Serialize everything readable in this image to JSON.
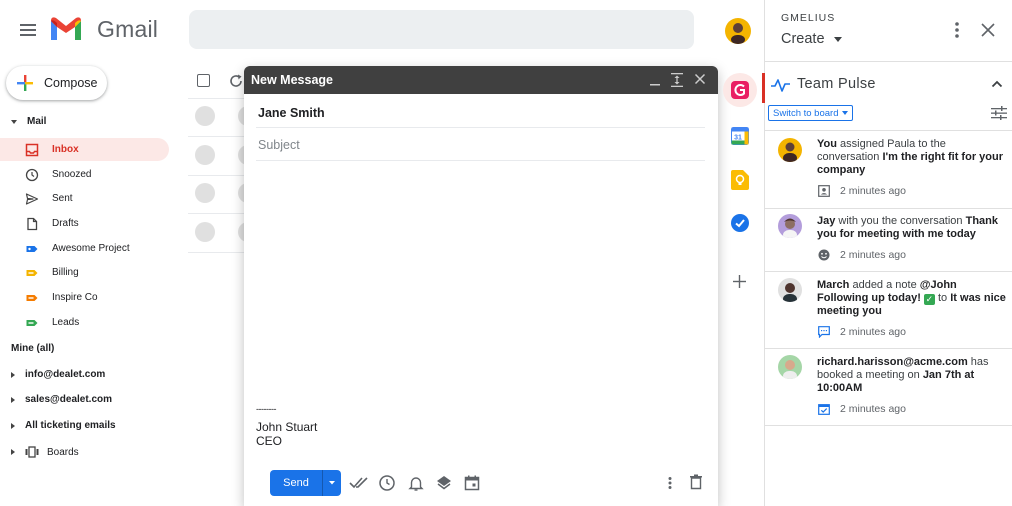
{
  "header": {
    "app_name": "Gmail",
    "menu_icon": "hamburger-menu-icon",
    "logo_icon": "gmail-logo-icon"
  },
  "nav": {
    "compose_label": "Compose",
    "mail_section": "Mail",
    "items": [
      {
        "label": "Inbox",
        "icon": "inbox-icon",
        "active": true
      },
      {
        "label": "Snoozed",
        "icon": "clock-icon"
      },
      {
        "label": "Sent",
        "icon": "send-icon"
      },
      {
        "label": "Drafts",
        "icon": "draft-icon"
      },
      {
        "label": "Awesome Project",
        "icon": "label-icon",
        "color": "#1a73e8"
      },
      {
        "label": "Billing",
        "icon": "label-icon",
        "color": "#f4b400"
      },
      {
        "label": "Inspire Co",
        "icon": "label-icon",
        "color": "#f57c00"
      },
      {
        "label": "Leads",
        "icon": "label-icon",
        "color": "#34a853"
      }
    ],
    "mine_section": "Mine (all)",
    "accounts": [
      "info@dealet.com",
      "sales@dealet.com",
      "All ticketing emails"
    ],
    "boards_label": "Boards"
  },
  "compose": {
    "title": "New Message",
    "to": "Jane Smith",
    "subject_placeholder": "Subject",
    "signature_sep": "--------",
    "signature_name": "John Stuart",
    "signature_title": "CEO",
    "send_label": "Send"
  },
  "panel": {
    "brand": "GMELIUS",
    "create_label": "Create",
    "section_title": "Team Pulse",
    "switch_label": "Switch to board",
    "activities": [
      {
        "actor": "You",
        "text1": " assigned Paula to the conversation ",
        "bold2": "I'm the right fit for your company",
        "time": "2 minutes ago",
        "meta_icon": "assign-icon"
      },
      {
        "actor": "Jay",
        "text1": " with you the conversation ",
        "bold2": "Thank you for meeting with me today",
        "time": "2 minutes ago",
        "meta_icon": "emoji-icon"
      },
      {
        "actor": "March",
        "text1": " added a note ",
        "bold2": "@John Following up today!",
        "text3": " to ",
        "bold4": "It was nice meeting you",
        "time": "2 minutes ago",
        "meta_icon": "note-icon"
      },
      {
        "actor": "richard.harisson@acme.com",
        "text1": " has booked a meeting on ",
        "bold2": "Jan 7th at 10:00AM",
        "time": "2 minutes ago",
        "meta_icon": "calendar-check-icon"
      }
    ]
  },
  "colors": {
    "accent_red": "#d93025",
    "primary_blue": "#1a73e8",
    "compose_header": "#404040"
  }
}
